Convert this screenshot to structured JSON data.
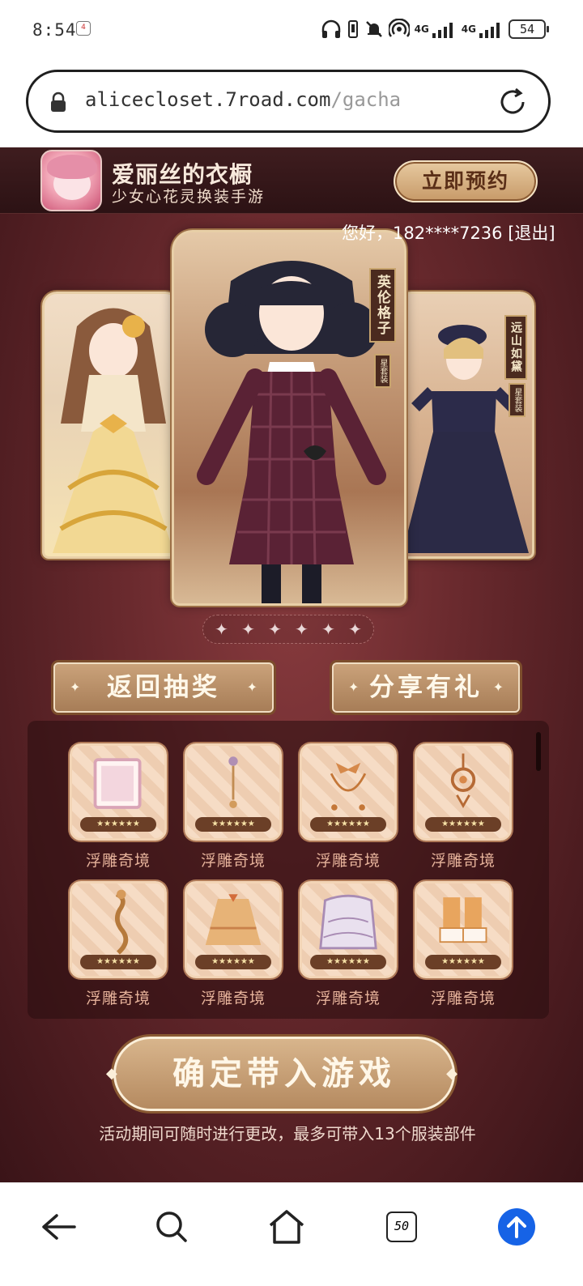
{
  "status_bar": {
    "time": "8:54",
    "notification_icon": "app-notification-icon",
    "signal1_label": "4G",
    "signal2_label": "4G",
    "battery": "54"
  },
  "browser": {
    "url_domain": "alicecloset.7road.com",
    "url_path": "/gacha"
  },
  "header": {
    "app_name": "爱丽丝的衣橱",
    "app_subtitle": "少女心花灵换装手游",
    "reserve_label": "立即预约"
  },
  "user": {
    "greeting": "您好，182****7236 [退出]"
  },
  "carousel": {
    "center_label": "英伦格子",
    "center_sub": "星套装",
    "right_label": "远山如黛",
    "right_sub": "星套装",
    "dot": "✦",
    "dot_count": 6
  },
  "actions": {
    "back_label": "返回抽奖",
    "share_label": "分享有礼",
    "spark": "✦"
  },
  "items": [
    {
      "name": "浮雕奇境",
      "stars": "★★★★★★",
      "icon": "frame-icon"
    },
    {
      "name": "浮雕奇境",
      "stars": "★★★★★★",
      "icon": "earring-icon"
    },
    {
      "name": "浮雕奇境",
      "stars": "★★★★★★",
      "icon": "bow-necklace-icon"
    },
    {
      "name": "浮雕奇境",
      "stars": "★★★★★★",
      "icon": "pendant-icon"
    },
    {
      "name": "浮雕奇境",
      "stars": "★★★★★★",
      "icon": "hair-ribbon-icon"
    },
    {
      "name": "浮雕奇境",
      "stars": "★★★★★★",
      "icon": "skirt-icon"
    },
    {
      "name": "浮雕奇境",
      "stars": "★★★★★★",
      "icon": "dress-icon"
    },
    {
      "name": "浮雕奇境",
      "stars": "★★★★★★",
      "icon": "shoes-icon"
    }
  ],
  "confirm": {
    "label": "确定带入游戏",
    "notice": "活动期间可随时进行更改，最多可带入13个服装部件"
  },
  "bottom_nav": {
    "tabs_count": "50"
  },
  "colors": {
    "page_bg": "#6a2a2e",
    "gold": "#c79a68",
    "nav_accent": "#1663e6"
  }
}
